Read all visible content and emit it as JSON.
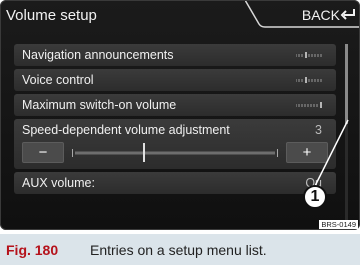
{
  "screen": {
    "title": "Volume setup",
    "back_label": "BACK"
  },
  "menu": {
    "items": [
      {
        "label": "Navigation announcements",
        "indicator": "volume-mini-scale"
      },
      {
        "label": "Voice control",
        "indicator": "volume-mini-scale"
      },
      {
        "label": "Maximum switch-on volume",
        "indicator": "volume-mini-scale"
      },
      {
        "label": "Speed-dependent volume adjustment",
        "value": "3",
        "expanded": true
      },
      {
        "label": "AUX volume:",
        "value": "Qu"
      }
    ],
    "adjust": {
      "minus": "−",
      "plus": "+",
      "level_fraction": 0.45
    }
  },
  "callout": {
    "number": "1"
  },
  "reference_code": "BRS-0149",
  "caption": {
    "figure": "Fig. 180",
    "text": "Entries on a setup menu list."
  },
  "colors": {
    "accent_red": "#b5121b",
    "caption_bg": "#dbe4ea",
    "screen_bg": "#151515"
  },
  "icons": {
    "back": "return-arrow-icon"
  }
}
